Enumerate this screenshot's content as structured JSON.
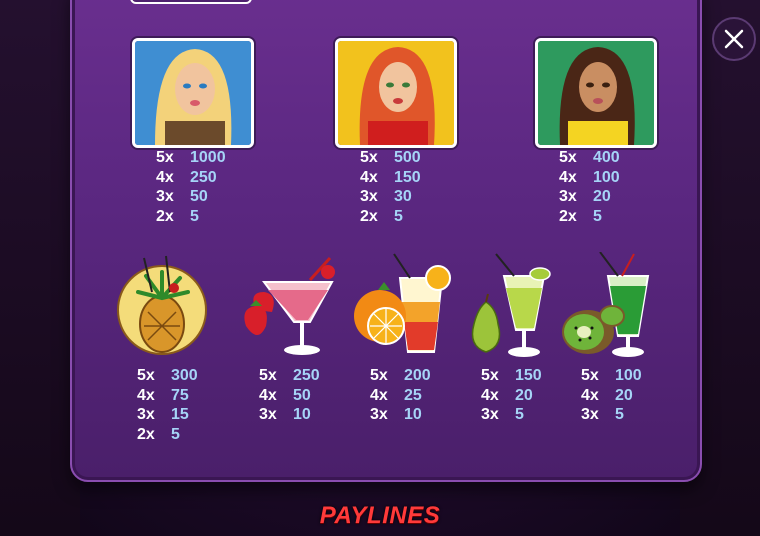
{
  "symbols_top": [
    {
      "name": "blonde-girl",
      "pays": [
        [
          "5x",
          "1000"
        ],
        [
          "4x",
          "250"
        ],
        [
          "3x",
          "50"
        ],
        [
          "2x",
          "5"
        ]
      ]
    },
    {
      "name": "redhead-girl",
      "pays": [
        [
          "5x",
          "500"
        ],
        [
          "4x",
          "150"
        ],
        [
          "3x",
          "30"
        ],
        [
          "2x",
          "5"
        ]
      ]
    },
    {
      "name": "brunette-girl",
      "pays": [
        [
          "5x",
          "400"
        ],
        [
          "4x",
          "100"
        ],
        [
          "3x",
          "20"
        ],
        [
          "2x",
          "5"
        ]
      ]
    }
  ],
  "symbols_bottom": [
    {
      "name": "pineapple-cocktail",
      "pays": [
        [
          "5x",
          "300"
        ],
        [
          "4x",
          "75"
        ],
        [
          "3x",
          "15"
        ],
        [
          "2x",
          "5"
        ]
      ]
    },
    {
      "name": "strawberry-cocktail",
      "pays": [
        [
          "5x",
          "250"
        ],
        [
          "4x",
          "50"
        ],
        [
          "3x",
          "10"
        ]
      ]
    },
    {
      "name": "orange-cocktail",
      "pays": [
        [
          "5x",
          "200"
        ],
        [
          "4x",
          "25"
        ],
        [
          "3x",
          "10"
        ]
      ]
    },
    {
      "name": "pear-cocktail",
      "pays": [
        [
          "5x",
          "150"
        ],
        [
          "4x",
          "20"
        ],
        [
          "3x",
          "5"
        ]
      ]
    },
    {
      "name": "kiwi-cocktail",
      "pays": [
        [
          "5x",
          "100"
        ],
        [
          "4x",
          "20"
        ],
        [
          "3x",
          "5"
        ]
      ]
    }
  ],
  "paylines_heading": "PAYLINES",
  "icons": {
    "close": "close-icon"
  },
  "colors": {
    "panel": "#5a2780",
    "value": "#a6d4f7",
    "heading": "#ff3a3a"
  }
}
